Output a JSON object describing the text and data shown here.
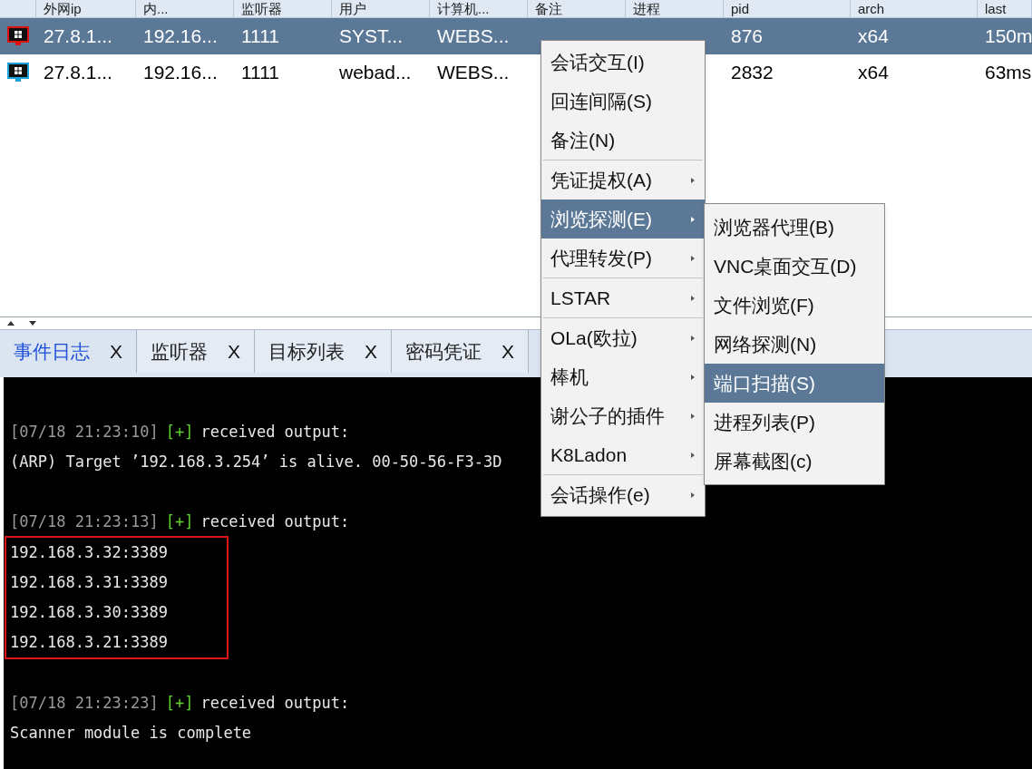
{
  "table": {
    "columns": [
      "外网ip",
      "内...",
      "监听器",
      "用户",
      "计算机...",
      "备注",
      "进程",
      "pid",
      "arch",
      "last"
    ],
    "rows": [
      {
        "selected": true,
        "kind": "admin",
        "cells": [
          "27.8.1...",
          "192.16...",
          "1111",
          "SYST...",
          "WEBS...",
          "",
          "",
          "876",
          "x64",
          "150m"
        ]
      },
      {
        "selected": false,
        "kind": "user",
        "cells": [
          "27.8.1...",
          "192.16...",
          "1111",
          "webad...",
          "WEBS...",
          "",
          "",
          "2832",
          "x64",
          "63ms"
        ]
      }
    ]
  },
  "tabs": [
    {
      "label": "事件日志",
      "selected": true,
      "close": "X"
    },
    {
      "label": "监听器",
      "selected": false,
      "close": "X"
    },
    {
      "label": "目标列表",
      "selected": false,
      "close": "X"
    },
    {
      "label": "密码凭证",
      "selected": false,
      "close": "X"
    }
  ],
  "console": [
    {
      "kind": "blank"
    },
    {
      "kind": "event",
      "time": "[07/18 21:23:10]",
      "mark": "[+]",
      "text": "received output:"
    },
    {
      "kind": "plain",
      "text": "(ARP) Target ’192.168.3.254’ is alive. 00-50-56-F3-3D"
    },
    {
      "kind": "blank"
    },
    {
      "kind": "event",
      "time": "[07/18 21:23:13]",
      "mark": "[+]",
      "text": "received output:"
    },
    {
      "kind": "highlight",
      "lines": [
        "192.168.3.32:3389",
        "192.168.3.31:3389",
        "192.168.3.30:3389",
        "192.168.3.21:3389"
      ]
    },
    {
      "kind": "blank"
    },
    {
      "kind": "event",
      "time": "[07/18 21:23:23]",
      "mark": "[+]",
      "text": "received output:"
    },
    {
      "kind": "plain",
      "text": "Scanner module is complete"
    }
  ],
  "context_menu": {
    "groups": [
      [
        {
          "label": "会话交互(I)",
          "submenu": false,
          "selected": false
        },
        {
          "label": "回连间隔(S)",
          "submenu": false,
          "selected": false
        },
        {
          "label": "备注(N)",
          "submenu": false,
          "selected": false
        }
      ],
      [
        {
          "label": "凭证提权(A)",
          "submenu": true,
          "selected": false
        },
        {
          "label": "浏览探测(E)",
          "submenu": true,
          "selected": true
        },
        {
          "label": "代理转发(P)",
          "submenu": true,
          "selected": false
        }
      ],
      [
        {
          "label": "LSTAR",
          "submenu": true,
          "selected": false
        }
      ],
      [
        {
          "label": "OLa(欧拉)",
          "submenu": true,
          "selected": false
        },
        {
          "label": "棒机",
          "submenu": true,
          "selected": false
        },
        {
          "label": "谢公子的插件",
          "submenu": true,
          "selected": false
        },
        {
          "label": "K8Ladon",
          "submenu": true,
          "selected": false
        }
      ],
      [
        {
          "label": "会话操作(e)",
          "submenu": true,
          "selected": false
        }
      ]
    ]
  },
  "submenu": {
    "items": [
      {
        "label": "浏览器代理(B)",
        "selected": false
      },
      {
        "label": "VNC桌面交互(D)",
        "selected": false
      },
      {
        "label": "文件浏览(F)",
        "selected": false
      },
      {
        "label": "网络探测(N)",
        "selected": false
      },
      {
        "label": "端口扫描(S)",
        "selected": true
      },
      {
        "label": "进程列表(P)",
        "selected": false
      },
      {
        "label": "屏幕截图(c)",
        "selected": false
      }
    ]
  }
}
